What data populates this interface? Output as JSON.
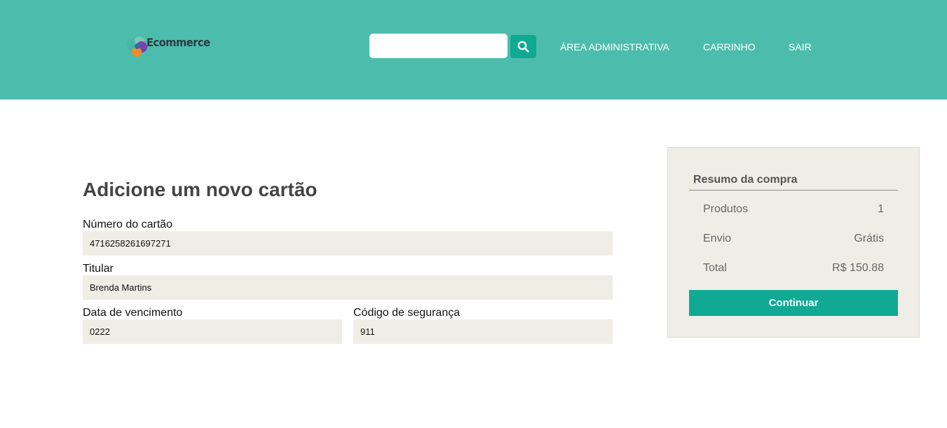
{
  "header": {
    "logo_text": "Ecommerce",
    "search": {
      "value": "",
      "placeholder": ""
    },
    "nav": {
      "admin": "ÁREA ADMINISTRATIVA",
      "cart": "CARRINHO",
      "exit": "SAIR"
    },
    "colors": {
      "background": "#4cbdac",
      "accent": "#0fa994"
    }
  },
  "card_form": {
    "title": "Adicione um novo cartão",
    "card_number": {
      "label": "Número do cartão",
      "value": "4716258261697271"
    },
    "holder": {
      "label": "Titular",
      "value": "Brenda Martins"
    },
    "expiry": {
      "label": "Data de vencimento",
      "value": "0222"
    },
    "security_code": {
      "label": "Código de segurança",
      "value": "911"
    }
  },
  "summary": {
    "title": "Resumo da compra",
    "products": {
      "label": "Produtos",
      "value": "1"
    },
    "shipping": {
      "label": "Envio",
      "value": "Grátis"
    },
    "total": {
      "label": "Total",
      "value": "R$ 150.88"
    },
    "continue_label": "Continuar"
  },
  "icons": {
    "logo": "ecommerce-logo-icon",
    "search": "search-icon"
  }
}
